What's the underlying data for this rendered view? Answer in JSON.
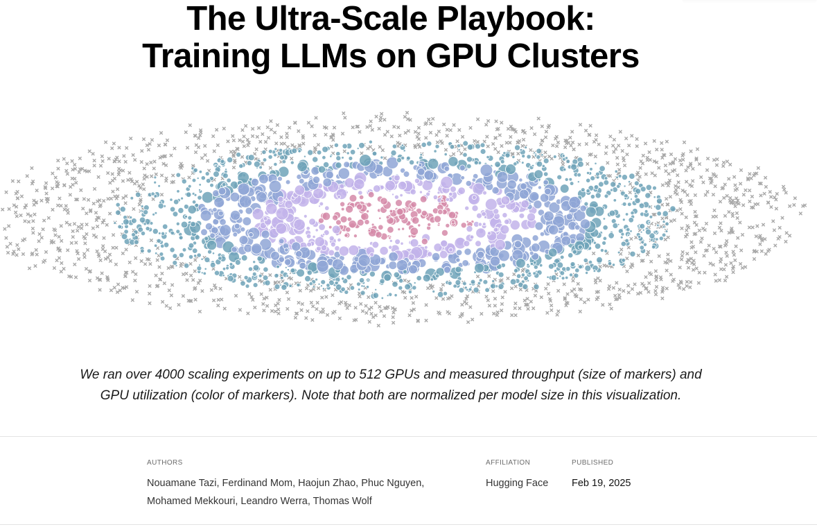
{
  "header": {
    "title_line1": "The Ultra-Scale Playbook:",
    "title_line2": "Training LLMs on GPU Clusters"
  },
  "banner": {
    "marker_colors": {
      "outer_cross": "#a8a8a8",
      "teal": "#6fa3b8",
      "blue": "#8fa6d6",
      "lavender": "#c2b3ea",
      "pink": "#d58aa8"
    },
    "marker_shapes": [
      "cross",
      "circle"
    ]
  },
  "caption": {
    "line1": "We ran over 4000 scaling experiments on up to 512 GPUs and measured throughput (size of markers) and",
    "line2": "GPU utilization (color of markers). Note that both are normalized per model size in this visualization."
  },
  "meta": {
    "authors_label": "AUTHORS",
    "authors_line1": "Nouamane Tazi, Ferdinand Mom, Haojun Zhao, Phuc Nguyen,",
    "authors_line2": "Mohamed Mekkouri, Leandro Werra, Thomas Wolf",
    "affiliation_label": "AFFILIATION",
    "affiliation": "Hugging Face",
    "published_label": "PUBLISHED",
    "published": "Feb 19, 2025"
  }
}
